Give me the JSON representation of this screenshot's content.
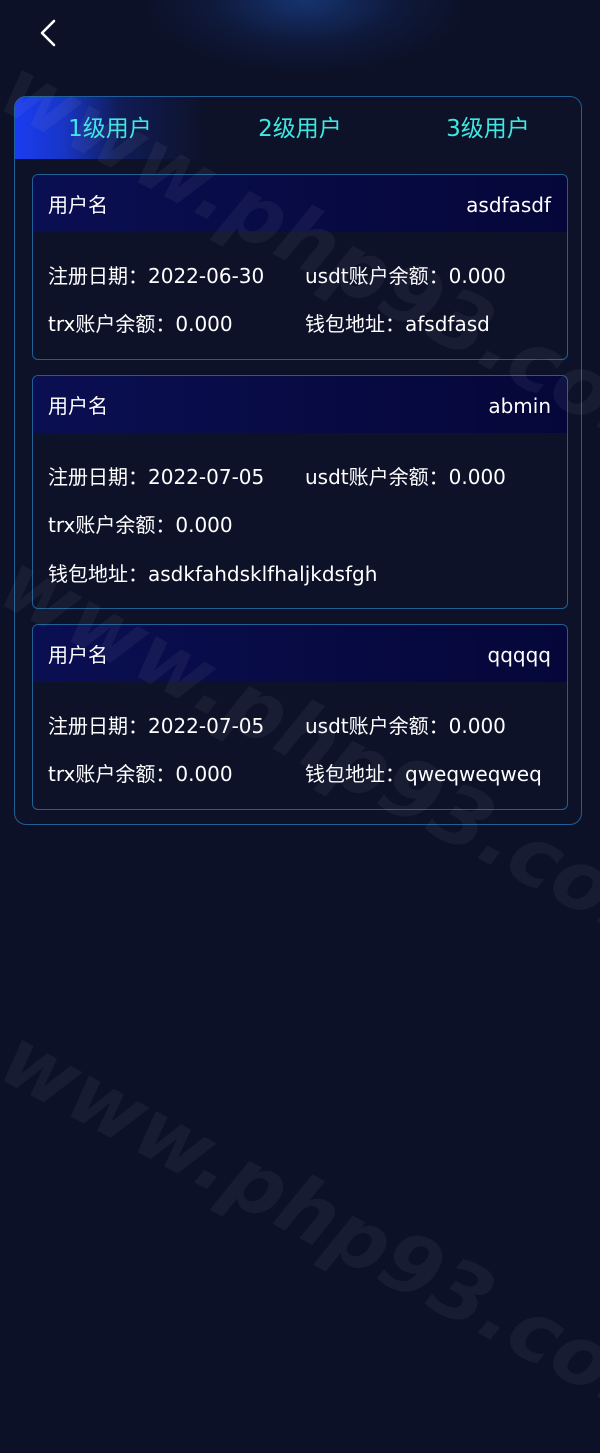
{
  "tabs": [
    "1级用户",
    "2级用户",
    "3级用户"
  ],
  "cards": [
    {
      "username_label": "用户名",
      "username": "asdfasdf",
      "reg_date": "注册日期：2022-06-30",
      "usdt_balance": "usdt账户余额：0.000",
      "trx_balance": "trx账户余额：0.000",
      "wallet": "钱包地址：afsdfasd"
    },
    {
      "username_label": "用户名",
      "username": "abmin",
      "reg_date": "注册日期：2022-07-05",
      "usdt_balance": "usdt账户余额：0.000",
      "trx_balance": "trx账户余额：0.000",
      "wallet": "钱包地址：asdkfahdsklfhaljkdsfgh"
    },
    {
      "username_label": "用户名",
      "username": "qqqqq",
      "reg_date": "注册日期：2022-07-05",
      "usdt_balance": "usdt账户余额：0.000",
      "trx_balance": "trx账户余额：0.000",
      "wallet": "钱包地址：qweqweqweq"
    }
  ],
  "watermark": "www.php93.com"
}
